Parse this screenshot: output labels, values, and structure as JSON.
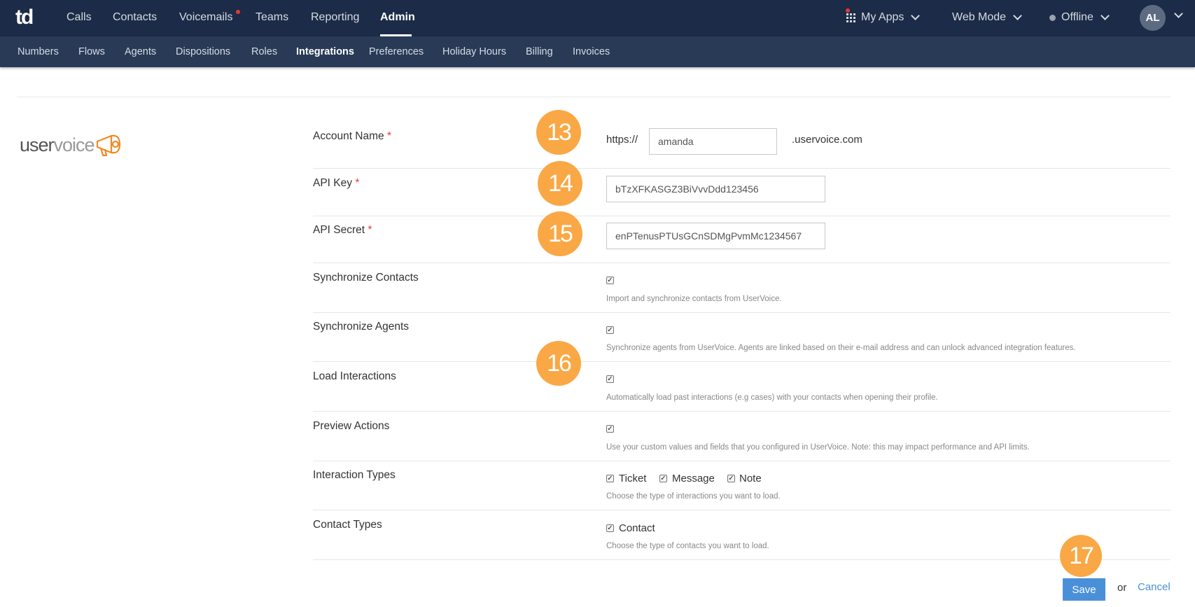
{
  "topnav": {
    "logo": "td",
    "items": [
      {
        "label": "Calls"
      },
      {
        "label": "Contacts"
      },
      {
        "label": "Voicemails"
      },
      {
        "label": "Teams"
      },
      {
        "label": "Reporting"
      },
      {
        "label": "Admin"
      }
    ],
    "active": "Admin",
    "my_apps": "My Apps",
    "web_mode": "Web Mode",
    "status": "Offline",
    "avatar": "AL"
  },
  "subnav": {
    "items": [
      {
        "label": "Numbers"
      },
      {
        "label": "Flows"
      },
      {
        "label": "Agents"
      },
      {
        "label": "Dispositions"
      },
      {
        "label": "Roles"
      },
      {
        "label": "Integrations"
      },
      {
        "label": "Preferences"
      },
      {
        "label": "Holiday Hours"
      },
      {
        "label": "Billing"
      },
      {
        "label": "Invoices"
      }
    ],
    "active": "Integrations"
  },
  "brand": {
    "logo_text_a": "user",
    "logo_text_b": "voice",
    "accent": "#f08a24"
  },
  "form": {
    "account_name": {
      "label": "Account Name",
      "prefix": "https://",
      "value": "amanda",
      "suffix": ".uservoice.com"
    },
    "api_key": {
      "label": "API Key",
      "value": "bTzXFKASGZ3BiVvvDdd123456"
    },
    "api_secret": {
      "label": "API Secret",
      "value": "enPTenusPTUsGCnSDMgPvmMc1234567"
    },
    "required_mark": "*",
    "sync_contacts": {
      "label": "Synchronize Contacts",
      "help": "Import and synchronize contacts from UserVoice.",
      "checked": true
    },
    "sync_agents": {
      "label": "Synchronize Agents",
      "help": "Synchronize agents from UserVoice. Agents are linked based on their e-mail address and can unlock advanced integration features.",
      "checked": true
    },
    "load_interactions": {
      "label": "Load Interactions",
      "help": "Automatically load past interactions (e.g cases) with your contacts when opening their profile.",
      "checked": true
    },
    "preview_actions": {
      "label": "Preview Actions",
      "help": "Use your custom values and fields that you configured in UserVoice. Note: this may impact performance and API limits.",
      "checked": true
    },
    "interaction_types": {
      "label": "Interaction Types",
      "options": [
        "Ticket",
        "Message",
        "Note"
      ],
      "help": "Choose the type of interactions you want to load."
    },
    "contact_types": {
      "label": "Contact Types",
      "options": [
        "Contact"
      ],
      "help": "Choose the type of contacts you want to load."
    }
  },
  "badges": [
    "13",
    "14",
    "15",
    "16",
    "17"
  ],
  "actions": {
    "save": "Save",
    "or": "or",
    "cancel": "Cancel"
  },
  "colors": {
    "topbar": "#1c2b47",
    "subbar": "#283a56",
    "badge": "#f9a845",
    "primary": "#4a90d9"
  }
}
